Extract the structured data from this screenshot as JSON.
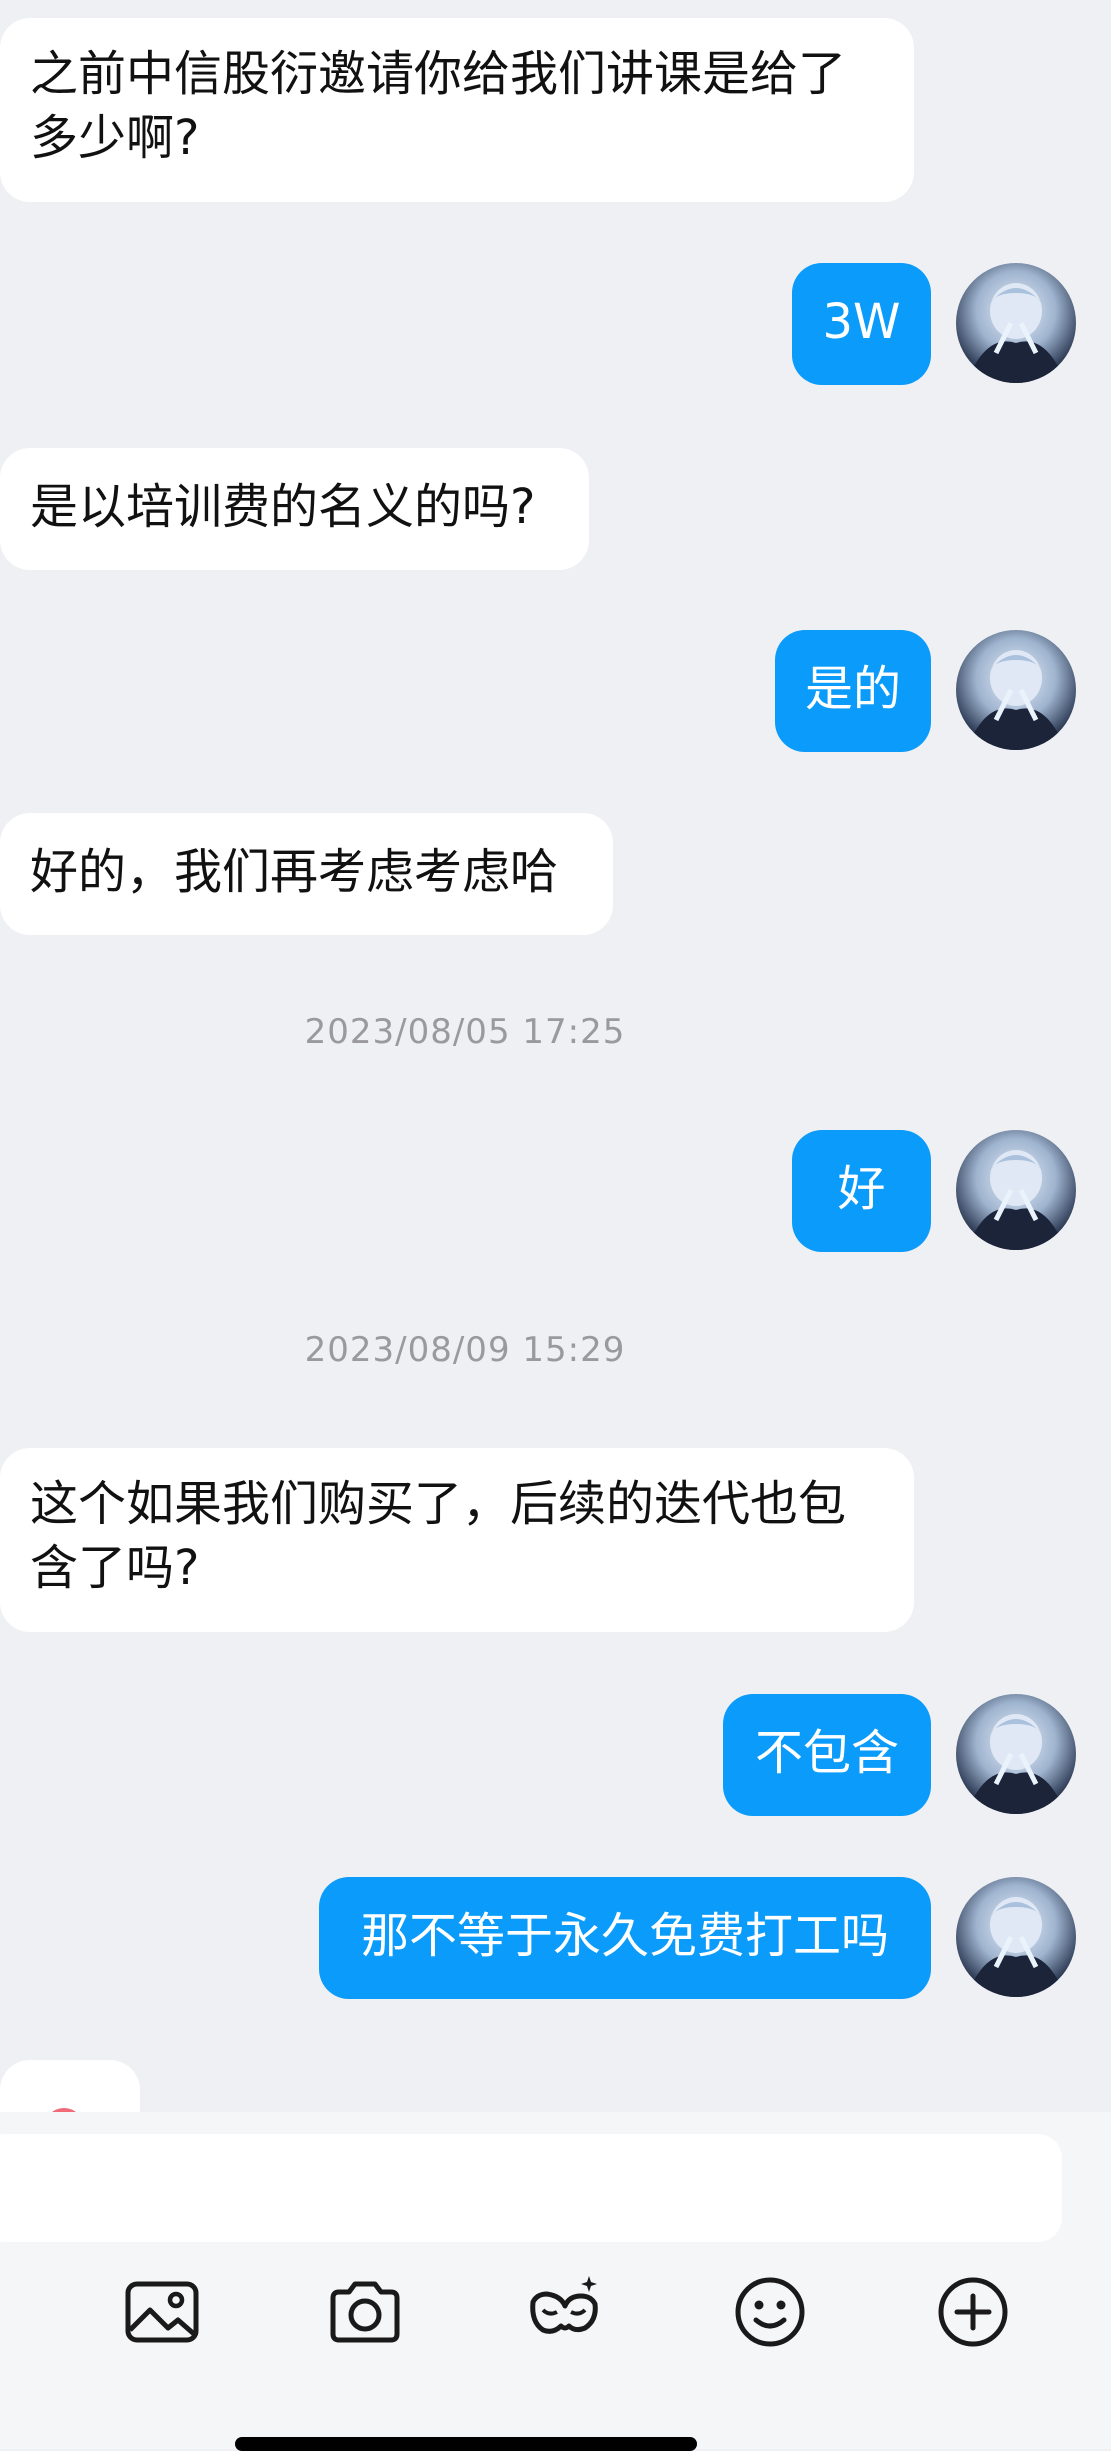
{
  "messages": [
    {
      "side": "in",
      "text": "之前中信股衍邀请你给我们讲课是给了\n多少啊?"
    },
    {
      "side": "out",
      "text": "3W"
    },
    {
      "side": "in",
      "text": "是以培训费的名义的吗?"
    },
    {
      "side": "out",
      "text": "是的"
    },
    {
      "side": "in",
      "text": "好的，我们再考虑考虑哈"
    },
    {
      "type": "timestamp",
      "text": "2023/08/05 17:25"
    },
    {
      "side": "out",
      "text": "好"
    },
    {
      "type": "timestamp",
      "text": "2023/08/09 15:29"
    },
    {
      "side": "in",
      "text": "这个如果我们购买了，后续的迭代也包\n含了吗?"
    },
    {
      "side": "out",
      "text": "不包含"
    },
    {
      "side": "out",
      "text": "那不等于永久免费打工吗"
    }
  ],
  "toolbar": {
    "icons": [
      "image-icon",
      "camera-icon",
      "mask-sparkle-icon",
      "smiley-icon",
      "plus-circle-icon"
    ]
  },
  "colors": {
    "background": "#eff0f4",
    "outgoing_bubble": "#0b9bfa",
    "incoming_bubble": "#ffffff"
  }
}
